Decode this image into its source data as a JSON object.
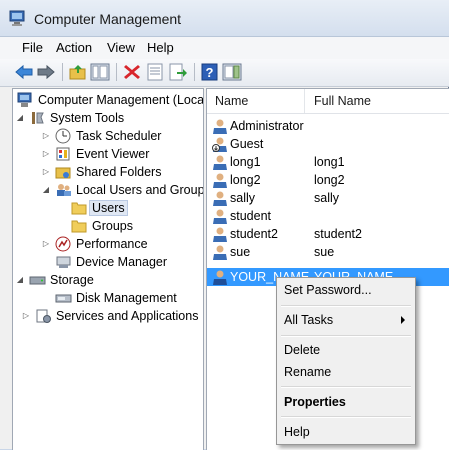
{
  "window": {
    "title": "Computer Management"
  },
  "menu": [
    "File",
    "Action",
    "View",
    "Help"
  ],
  "toolbar": {
    "buttons": [
      "back-arrow-icon",
      "forward-arrow-icon",
      "up-folder-icon",
      "show-hide-tree-icon",
      "delete-icon",
      "properties-icon",
      "export-list-icon",
      "help-icon",
      "show-action-pane-icon"
    ]
  },
  "tree": {
    "root": "Computer Management (Local",
    "system_tools": "System Tools",
    "task_scheduler": "Task Scheduler",
    "event_viewer": "Event Viewer",
    "shared_folders": "Shared Folders",
    "local_users_groups": "Local Users and Groups",
    "users": "Users",
    "groups": "Groups",
    "performance": "Performance",
    "device_manager": "Device Manager",
    "storage": "Storage",
    "disk_management": "Disk Management",
    "services_apps": "Services and Applications"
  },
  "list": {
    "columns": [
      "Name",
      "Full Name"
    ],
    "rows": [
      {
        "name": "Administrator",
        "full": ""
      },
      {
        "name": "Guest",
        "full": ""
      },
      {
        "name": "long1",
        "full": "long1"
      },
      {
        "name": "long2",
        "full": "long2"
      },
      {
        "name": "sally",
        "full": "sally"
      },
      {
        "name": "student",
        "full": ""
      },
      {
        "name": "student2",
        "full": "student2"
      },
      {
        "name": "sue",
        "full": "sue"
      },
      {
        "name": "YOUR_NAME",
        "full": "YOUR_NAME"
      }
    ]
  },
  "context_menu": {
    "set_password": "Set Password...",
    "all_tasks": "All Tasks",
    "delete": "Delete",
    "rename": "Rename",
    "properties": "Properties",
    "help": "Help"
  },
  "colors": {
    "selection": "#3399ff",
    "window_bg": "#f0f0f0",
    "pane_bg": "#ffffff"
  }
}
